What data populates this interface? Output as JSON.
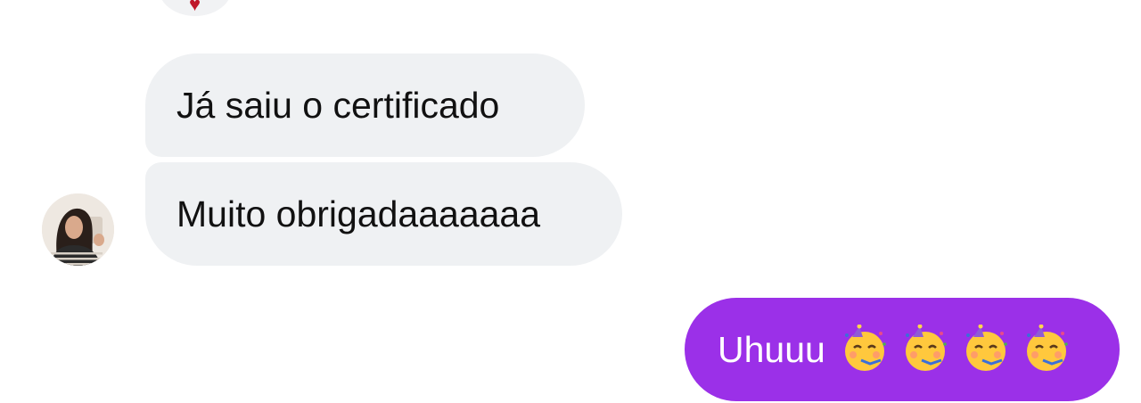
{
  "messages": {
    "incoming": [
      {
        "text": "Já saiu o certificado"
      },
      {
        "text": "Muito obrigadaaaaaaa"
      }
    ],
    "outgoing": [
      {
        "text": "Uhuuu",
        "emojis": [
          "partying-face-emoji",
          "partying-face-emoji",
          "partying-face-emoji",
          "partying-face-emoji"
        ]
      }
    ]
  },
  "colors": {
    "incoming_bubble": "#eff1f3",
    "outgoing_bubble": "#9b30e8",
    "outgoing_text": "#ffffff",
    "incoming_text": "#111111",
    "reaction_heart": "#c0182b"
  },
  "icons": {
    "reaction": "heart-icon",
    "avatar": "contact-avatar"
  }
}
